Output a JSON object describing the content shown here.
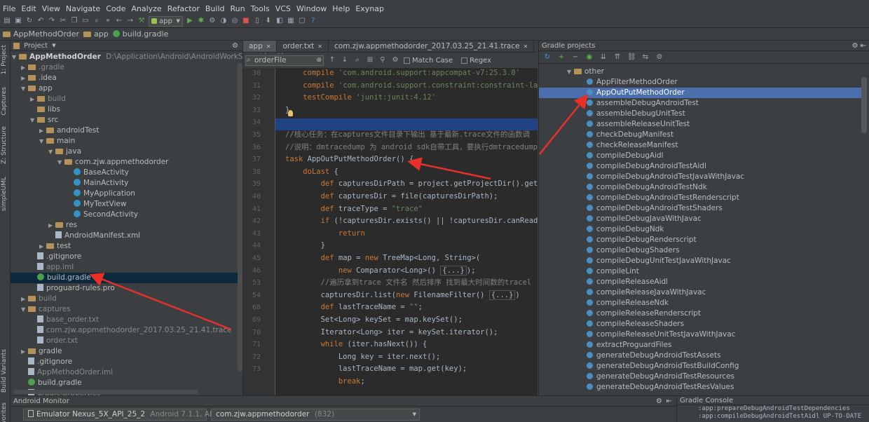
{
  "menu": [
    "File",
    "Edit",
    "View",
    "Navigate",
    "Code",
    "Analyze",
    "Refactor",
    "Build",
    "Run",
    "Tools",
    "VCS",
    "Window",
    "Help",
    "Exynap"
  ],
  "toolbar": {
    "run_config": "app"
  },
  "breadcrumb": [
    "AppMethodOrder",
    "app",
    "build.gradle"
  ],
  "side_tabs": [
    "1: Project",
    "Captures",
    "Z: Structure",
    "simpleUML",
    "Build Variants",
    "Favorites"
  ],
  "project": {
    "header": "Project",
    "root_name": "AppMethodOrder",
    "root_path": "D:\\Application\\Android\\AndroidWorkSpace\\AppMet",
    "items": [
      {
        "label": ".gradle",
        "kind": "folder",
        "depth": 1,
        "arrow": "▶",
        "muted": true
      },
      {
        "label": ".idea",
        "kind": "folder",
        "depth": 1,
        "arrow": "▶"
      },
      {
        "label": "app",
        "kind": "folder",
        "depth": 1,
        "arrow": "▼"
      },
      {
        "label": "build",
        "kind": "folder",
        "depth": 2,
        "arrow": "▶",
        "muted": true
      },
      {
        "label": "libs",
        "kind": "folder",
        "depth": 2,
        "arrow": ""
      },
      {
        "label": "src",
        "kind": "folder",
        "depth": 2,
        "arrow": "▼"
      },
      {
        "label": "androidTest",
        "kind": "folder",
        "depth": 3,
        "arrow": "▶"
      },
      {
        "label": "main",
        "kind": "folder",
        "depth": 3,
        "arrow": "▼"
      },
      {
        "label": "java",
        "kind": "folder",
        "depth": 4,
        "arrow": "▼"
      },
      {
        "label": "com.zjw.appmethodorder",
        "kind": "folder",
        "depth": 5,
        "arrow": "▼"
      },
      {
        "label": "BaseActivity",
        "kind": "class",
        "depth": 6,
        "arrow": ""
      },
      {
        "label": "MainActivity",
        "kind": "class",
        "depth": 6,
        "arrow": ""
      },
      {
        "label": "MyApplication",
        "kind": "class",
        "depth": 6,
        "arrow": ""
      },
      {
        "label": "MyTextView",
        "kind": "class",
        "depth": 6,
        "arrow": ""
      },
      {
        "label": "SecondActivity",
        "kind": "class",
        "depth": 6,
        "arrow": ""
      },
      {
        "label": "res",
        "kind": "folder",
        "depth": 4,
        "arrow": "▶"
      },
      {
        "label": "AndroidManifest.xml",
        "kind": "file",
        "depth": 4,
        "arrow": ""
      },
      {
        "label": "test",
        "kind": "folder",
        "depth": 3,
        "arrow": "▶"
      },
      {
        "label": ".gitignore",
        "kind": "file",
        "depth": 2,
        "arrow": ""
      },
      {
        "label": "app.iml",
        "kind": "file",
        "depth": 2,
        "arrow": "",
        "muted": true
      },
      {
        "label": "build.gradle",
        "kind": "gradle",
        "depth": 2,
        "arrow": "",
        "selected": true
      },
      {
        "label": "proguard-rules.pro",
        "kind": "file",
        "depth": 2,
        "arrow": ""
      },
      {
        "label": "build",
        "kind": "folder",
        "depth": 1,
        "arrow": "▶",
        "muted": true
      },
      {
        "label": "captures",
        "kind": "folder",
        "depth": 1,
        "arrow": "▼",
        "muted": true
      },
      {
        "label": "base_order.txt",
        "kind": "file",
        "depth": 2,
        "arrow": "",
        "muted": true
      },
      {
        "label": "com.zjw.appmethodorder_2017.03.25_21.41.trace",
        "kind": "file",
        "depth": 2,
        "arrow": "",
        "muted": true
      },
      {
        "label": "order.txt",
        "kind": "file",
        "depth": 2,
        "arrow": "",
        "muted": true
      },
      {
        "label": "gradle",
        "kind": "folder",
        "depth": 1,
        "arrow": "▶"
      },
      {
        "label": ".gitignore",
        "kind": "file",
        "depth": 1,
        "arrow": ""
      },
      {
        "label": "AppMethodOrder.iml",
        "kind": "file",
        "depth": 1,
        "arrow": "",
        "muted": true
      },
      {
        "label": "build.gradle",
        "kind": "gradle",
        "depth": 1,
        "arrow": ""
      },
      {
        "label": "gradle.properties",
        "kind": "file",
        "depth": 1,
        "arrow": "",
        "muted": true
      }
    ]
  },
  "editor": {
    "tabs": [
      {
        "label": "app",
        "active": true
      },
      {
        "label": "order.txt",
        "active": false
      },
      {
        "label": "com.zjw.appmethodorder_2017.03.25_21.41.trace",
        "active": false
      }
    ],
    "search_value": "orderFile",
    "match_case": "Match Case",
    "regex": "Regex",
    "line_numbers": [
      "30",
      "31",
      "32",
      "33",
      "34",
      "35",
      "36",
      "37",
      "38",
      "39",
      "40",
      "41",
      "42",
      "43",
      "44",
      "45",
      "46",
      "53",
      "54",
      "68",
      "69",
      "70",
      "71",
      "72",
      "73"
    ],
    "lines": [
      "    compile 'com.android.support:appcompat-v7:25.3.0'",
      "    compile 'com.android.support.constraint:constraint-layout:",
      "    testCompile 'junit:junit:4.12'",
      "}",
      "",
      "//核心任务：在captures文件目录下输出 基于最新.trace文件的函数调",
      "//说明：dmtracedump 为 android sdk自带工具，要执行dmtracedump",
      "task AppOutPutMethodOrder() {",
      "    doLast {",
      "        def capturesDirPath = project.getProjectDir().getParen",
      "        def capturesDir = file(capturesDirPath);",
      "        def traceType = \"trace\"",
      "        if (!capturesDir.exists() || !capturesDir.canRead())",
      "            return",
      "        }",
      "        def map = new TreeMap<Long, String>(",
      "            new Comparator<Long>() {...});",
      "        //遍历拿到trace 文件名 然后排序 找到最大时间数的tracel",
      "        capturesDir.list(new FilenameFilter() {...})",
      "        def lastTraceName = \"\";",
      "        Set<Long> keySet = map.keySet();",
      "        Iterator<Long> iter = keySet.iterator();",
      "        while (iter.hasNext()) {",
      "            Long key = iter.next();",
      "            lastTraceName = map.get(key);",
      "            break;"
    ]
  },
  "gradle_panel": {
    "title": "Gradle projects",
    "group": "other",
    "tasks": [
      "AppFilterMethodOrder",
      "AppOutPutMethodOrder",
      "assembleDebugAndroidTest",
      "assembleDebugUnitTest",
      "assembleReleaseUnitTest",
      "checkDebugManifest",
      "checkReleaseManifest",
      "compileDebugAidl",
      "compileDebugAndroidTestAidl",
      "compileDebugAndroidTestJavaWithJavac",
      "compileDebugAndroidTestNdk",
      "compileDebugAndroidTestRenderscript",
      "compileDebugAndroidTestShaders",
      "compileDebugJavaWithJavac",
      "compileDebugNdk",
      "compileDebugRenderscript",
      "compileDebugShaders",
      "compileDebugUnitTestJavaWithJavac",
      "compileLint",
      "compileReleaseAidl",
      "compileReleaseJavaWithJavac",
      "compileReleaseNdk",
      "compileReleaseRenderscript",
      "compileReleaseShaders",
      "compileReleaseUnitTestJavaWithJavac",
      "extractProguardFiles",
      "generateDebugAndroidTestAssets",
      "generateDebugAndroidTestBuildConfig",
      "generateDebugAndroidTestResources",
      "generateDebugAndroidTestResValues"
    ],
    "selected_task": "AppOutPutMethodOrder"
  },
  "bottom": {
    "monitor_title": "Android Monitor",
    "device": "Emulator Nexus_5X_API_25_2",
    "device_info": "Android 7.1.1, API 25",
    "process": "com.zjw.appmethodorder",
    "process_pid": "(832)",
    "console_title": "Gradle Console",
    "console_line1": ":app:prepareDebugAndroidTestDependencies",
    "console_line2": ":app:compileDebugAndroidTestAidl UP-TO-DATE"
  },
  "colors": {
    "selection": "#4b6eaf",
    "accent_arrow": "#e8302a"
  }
}
